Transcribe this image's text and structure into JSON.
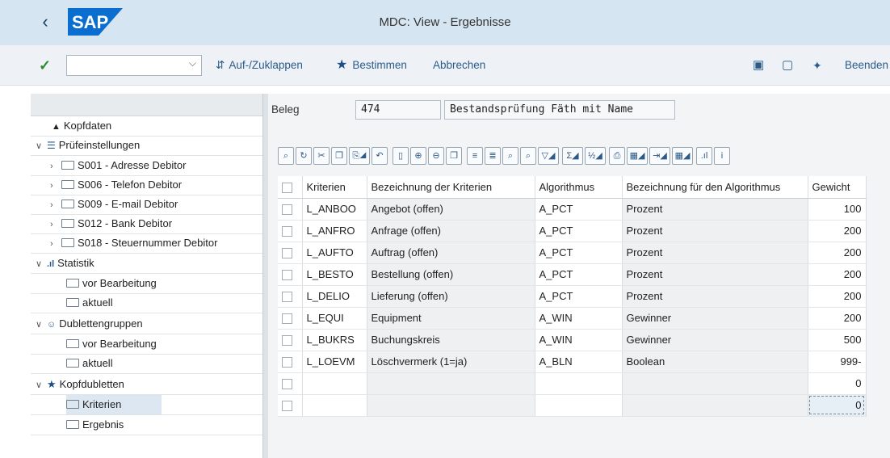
{
  "window": {
    "title": "MDC: View - Ergebnisse",
    "back_icon": "chevron-left-icon",
    "logo_text": "SAP"
  },
  "toolbar": {
    "ok_icon": "checkmark-icon",
    "command_field": {
      "value": "",
      "placeholder": ""
    },
    "items": [
      {
        "label": "Auf-/Zuklappen",
        "icon": "expand-collapse-icon"
      },
      {
        "label": "Bestimmen",
        "icon": "star-icon"
      },
      {
        "label": "Abbrechen"
      }
    ],
    "right_icons": [
      "layout-icon",
      "window-icon",
      "settings-icon"
    ],
    "exit_label": "Beenden"
  },
  "tree": {
    "items": [
      {
        "label": "Kopfdaten",
        "icon": "hat-icon"
      },
      {
        "label": "Prüfeinstellungen",
        "icon": "config-icon",
        "expanded": true
      },
      {
        "label": "S001 - Adresse Debitor",
        "icon": "folder-icon"
      },
      {
        "label": "S006 - Telefon Debitor",
        "icon": "folder-icon"
      },
      {
        "label": "S009 - E-mail Debitor",
        "icon": "folder-icon"
      },
      {
        "label": "S012 - Bank Debitor",
        "icon": "folder-icon"
      },
      {
        "label": "S018 - Steuernummer Debitor",
        "icon": "folder-icon"
      },
      {
        "label": "Statistik",
        "icon": "bar-chart-icon",
        "expanded": true
      },
      {
        "label": "vor Bearbeitung",
        "icon": "folder-icon"
      },
      {
        "label": "aktuell",
        "icon": "folder-icon"
      },
      {
        "label": "Dublettengruppen",
        "icon": "group-icon",
        "expanded": true
      },
      {
        "label": "vor Bearbeitung",
        "icon": "folder-icon"
      },
      {
        "label": "aktuell",
        "icon": "folder-icon"
      },
      {
        "label": "Kopfdubletten",
        "icon": "star-icon",
        "expanded": true
      },
      {
        "label": "Kriterien",
        "icon": "folder-icon",
        "selected": true
      },
      {
        "label": "Ergebnis",
        "icon": "folder-icon"
      }
    ]
  },
  "header": {
    "beleg_label": "Beleg",
    "beleg_value": "474",
    "beleg_text": "Bestandsprüfung Fäth mit Name"
  },
  "grid": {
    "columns": [
      "Kriterien",
      "Bezeichnung der Kriterien",
      "Algorithmus",
      "Bezeichnung für den Algorithmus",
      "Gewicht"
    ],
    "rows": [
      [
        "L_ANBOO",
        "Angebot (offen)",
        "A_PCT",
        "Prozent",
        "100"
      ],
      [
        "L_ANFRO",
        "Anfrage (offen)",
        "A_PCT",
        "Prozent",
        "200"
      ],
      [
        "L_AUFTO",
        "Auftrag (offen)",
        "A_PCT",
        "Prozent",
        "200"
      ],
      [
        "L_BESTO",
        "Bestellung (offen)",
        "A_PCT",
        "Prozent",
        "200"
      ],
      [
        "L_DELIO",
        "Lieferung (offen)",
        "A_PCT",
        "Prozent",
        "200"
      ],
      [
        "L_EQUI",
        "Equipment",
        "A_WIN",
        "Gewinner",
        "200"
      ],
      [
        "L_BUKRS",
        "Buchungskreis",
        "A_WIN",
        "Gewinner",
        "500"
      ],
      [
        "L_LOEVM",
        "Löschvermerk (1=ja)",
        "A_BLN",
        "Boolean",
        "999-"
      ],
      [
        "",
        "",
        "",
        "",
        "0"
      ],
      [
        "",
        "",
        "",
        "",
        "0"
      ]
    ]
  },
  "colors": {
    "titlebar": "#d6e5f2",
    "link": "#2b5b8a",
    "sap_blue": "#0a6ed1",
    "ok_green": "#2c8a2c"
  }
}
